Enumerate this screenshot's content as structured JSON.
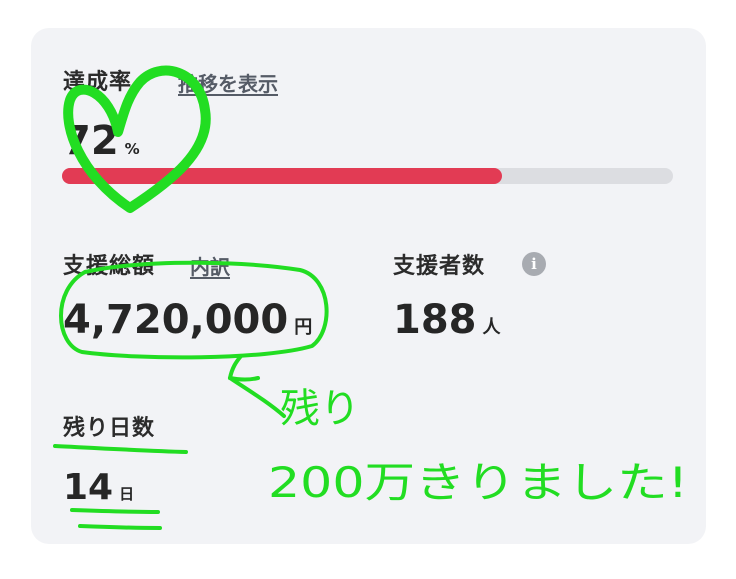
{
  "achievement": {
    "label": "達成率",
    "link": "推移を表示",
    "value": "72",
    "unit": "%",
    "progress_fraction": 0.72,
    "bar_color": "#e23b54"
  },
  "total_support": {
    "label": "支援総額",
    "link": "内訳",
    "value": "4,720,000",
    "unit": "円"
  },
  "supporters": {
    "label": "支援者数",
    "info_icon": "i",
    "value": "188",
    "unit": "人"
  },
  "remaining": {
    "label": "残り日数",
    "value": "14",
    "unit": "日"
  },
  "annotation": {
    "color": "#22dd22",
    "line1": "残り",
    "line2": "200万きりました!",
    "arrow_icon": "arrow-up-left-icon",
    "heart_icon": "heart-doodle-icon"
  }
}
